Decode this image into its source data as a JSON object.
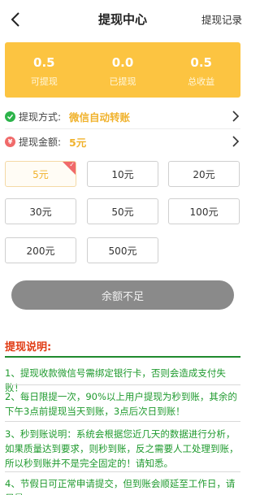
{
  "header": {
    "title": "提现中心",
    "records_label": "提现记录"
  },
  "stats": [
    {
      "value": "0.5",
      "label": "可提现"
    },
    {
      "value": "0.0",
      "label": "已提现"
    },
    {
      "value": "0.5",
      "label": "总收益"
    }
  ],
  "method": {
    "label": "提现方式:",
    "value": "微信自动转账"
  },
  "amount": {
    "label": "提现金额:",
    "value": "5元"
  },
  "amount_options": [
    "5元",
    "10元",
    "20元",
    "30元",
    "50元",
    "100元",
    "200元",
    "500元"
  ],
  "selected_option": "5元",
  "submit": {
    "label": "余额不足"
  },
  "notes": {
    "title": "提现说明:",
    "items": [
      "1、提现收款微信号需绑定银行卡，否则会造成支付失败！",
      "2、每日限提一次，90%以上用户提现为秒到账，其余的下午3点前提现当天到账，3点后次日到账！",
      "3、秒到账说明：系统会根据您近几天的数据进行分析，如果质量达到要求，则秒到账，反之需要人工处理到账，所以秒到账并不是完全固定的！请知悉。",
      "4、节假日可正常申请提交，但到账会顺延至工作日，请尽量"
    ]
  },
  "colors": {
    "accent": "#fcc441",
    "value_text": "#f0b22c",
    "notes_title": "#e03a12",
    "notes_text": "#1f9a2e",
    "submit_disabled": "#8a8a8a"
  }
}
